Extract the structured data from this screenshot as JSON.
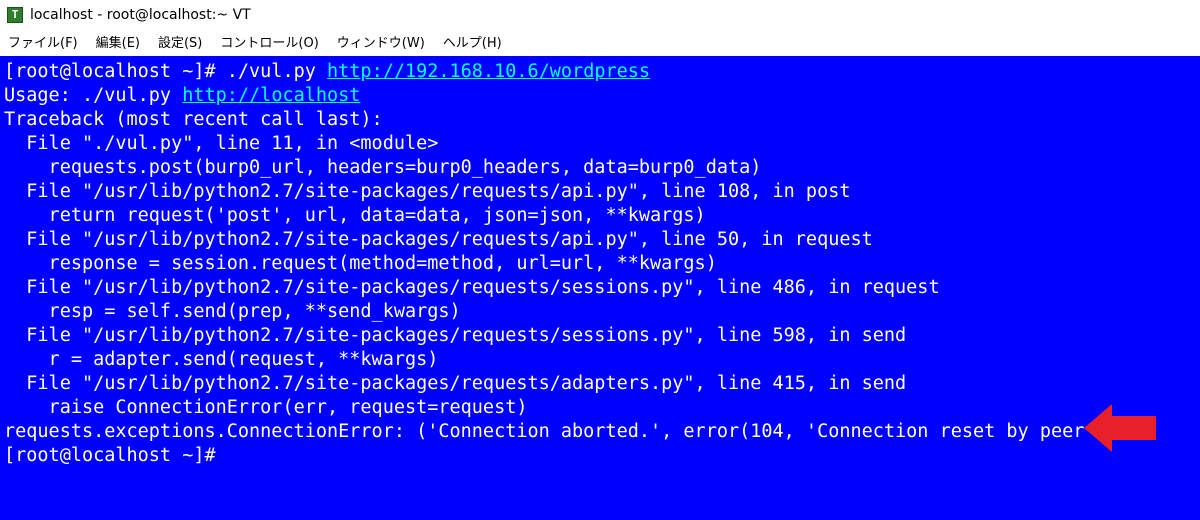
{
  "window": {
    "app_icon_glyph": "T",
    "title": "localhost - root@localhost:~ VT"
  },
  "menu": [
    {
      "label": "ファイル(F)",
      "name": "menu-file"
    },
    {
      "label": "編集(E)",
      "name": "menu-edit"
    },
    {
      "label": "設定(S)",
      "name": "menu-setup"
    },
    {
      "label": "コントロール(O)",
      "name": "menu-control"
    },
    {
      "label": "ウィンドウ(W)",
      "name": "menu-window"
    },
    {
      "label": "ヘルプ(H)",
      "name": "menu-help"
    }
  ],
  "terminal": {
    "background_color": "#0000ff",
    "text_color": "#ffffff",
    "link_color": "#00ffff",
    "lines": [
      {
        "text": "[root@localhost ~]# ./vul.py ",
        "link": "http://192.168.10.6/wordpress"
      },
      {
        "text": "Usage: ./vul.py ",
        "link": "http://localhost"
      },
      {
        "text": "Traceback (most recent call last):"
      },
      {
        "text": "  File \"./vul.py\", line 11, in <module>"
      },
      {
        "text": "    requests.post(burp0_url, headers=burp0_headers, data=burp0_data)"
      },
      {
        "text": "  File \"/usr/lib/python2.7/site-packages/requests/api.py\", line 108, in post"
      },
      {
        "text": "    return request('post', url, data=data, json=json, **kwargs)"
      },
      {
        "text": "  File \"/usr/lib/python2.7/site-packages/requests/api.py\", line 50, in request"
      },
      {
        "text": "    response = session.request(method=method, url=url, **kwargs)"
      },
      {
        "text": "  File \"/usr/lib/python2.7/site-packages/requests/sessions.py\", line 486, in request"
      },
      {
        "text": "    resp = self.send(prep, **send_kwargs)"
      },
      {
        "text": "  File \"/usr/lib/python2.7/site-packages/requests/sessions.py\", line 598, in send"
      },
      {
        "text": "    r = adapter.send(request, **kwargs)"
      },
      {
        "text": "  File \"/usr/lib/python2.7/site-packages/requests/adapters.py\", line 415, in send"
      },
      {
        "text": "    raise ConnectionError(err, request=request)"
      },
      {
        "text": "requests.exceptions.ConnectionError: ('Connection aborted.', error(104, 'Connection reset by peer'))"
      },
      {
        "text": "[root@localhost ~]#"
      }
    ]
  },
  "annotation": {
    "shape": "left-pointing-arrow",
    "color": "#e8202a"
  }
}
